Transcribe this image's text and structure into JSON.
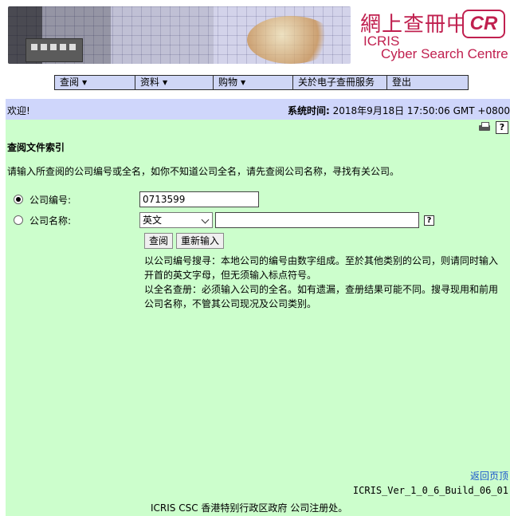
{
  "banner": {
    "title_cn": "網上查冊中心",
    "title_en1": "ICRIS",
    "title_en2": "Cyber Search Centre",
    "logo_text": "CR"
  },
  "menu": [
    {
      "label": "查阅",
      "has_dropdown": true
    },
    {
      "label": "资料",
      "has_dropdown": true
    },
    {
      "label": "购物",
      "has_dropdown": true
    },
    {
      "label": "关於电子查冊服务",
      "has_dropdown": false
    },
    {
      "label": "登出",
      "has_dropdown": false
    }
  ],
  "welcome": {
    "greeting": "欢迎!",
    "system_time_label": "系统时间:",
    "system_time_value": "2018年9月18日 17:50:06 GMT +0800"
  },
  "tools": {
    "print_icon": "printer-icon",
    "help_icon": "help-icon",
    "help_symbol": "?"
  },
  "form": {
    "title": "查阅文件索引",
    "intro": "请输入所查阅的公司编号或全名，如你不知道公司全名，请先查阅公司名称，寻找有关公司。",
    "company_number_label": "公司编号:",
    "company_number_value": "0713599",
    "company_name_label": "公司名称:",
    "language_selected": "英文",
    "company_name_value": "",
    "search_button": "查阅",
    "reset_button": "重新输入",
    "note1": "以公司编号搜寻：本地公司的编号由数字组成。至於其他类别的公司，则请同时输入开首的英文字母，但无须输入标点符号。",
    "note2": "以全名查册：必须输入公司的全名。如有遗漏，查册结果可能不同。搜寻现用和前用公司名称，不管其公司现况及公司类别。"
  },
  "footer": {
    "back_to_top": "返回页顶",
    "build": "ICRIS_Ver_1_0_6_Build_06_01",
    "credit": "ICRIS CSC 香港特别行政区政府 公司注册处。"
  }
}
